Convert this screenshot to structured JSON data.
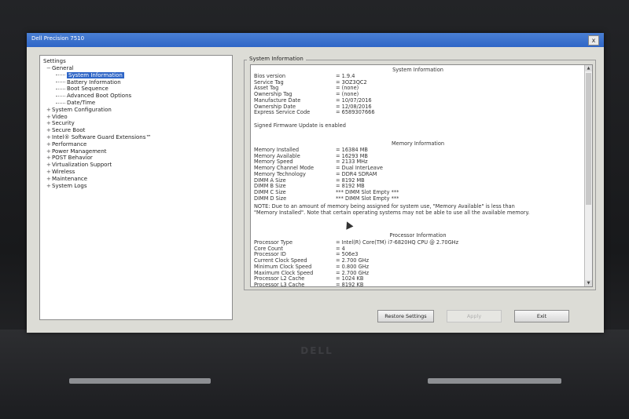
{
  "window": {
    "title": "Dell Precision 7510",
    "close_symbol": "x"
  },
  "tree": {
    "root": "Settings",
    "items": [
      {
        "label": "General",
        "level": 0,
        "expander": "−"
      },
      {
        "label": "System Information",
        "level": 1,
        "selected": true
      },
      {
        "label": "Battery Information",
        "level": 1
      },
      {
        "label": "Boot Sequence",
        "level": 1
      },
      {
        "label": "Advanced Boot Options",
        "level": 1
      },
      {
        "label": "Date/Time",
        "level": 1
      },
      {
        "label": "System Configuration",
        "level": 0,
        "expander": "+"
      },
      {
        "label": "Video",
        "level": 0,
        "expander": "+"
      },
      {
        "label": "Security",
        "level": 0,
        "expander": "+"
      },
      {
        "label": "Secure Boot",
        "level": 0,
        "expander": "+"
      },
      {
        "label": "Intel® Software Guard Extensions™",
        "level": 0,
        "expander": "+"
      },
      {
        "label": "Performance",
        "level": 0,
        "expander": "+"
      },
      {
        "label": "Power Management",
        "level": 0,
        "expander": "+"
      },
      {
        "label": "POST Behavior",
        "level": 0,
        "expander": "+"
      },
      {
        "label": "Virtualization Support",
        "level": 0,
        "expander": "+"
      },
      {
        "label": "Wireless",
        "level": 0,
        "expander": "+"
      },
      {
        "label": "Maintenance",
        "level": 0,
        "expander": "+"
      },
      {
        "label": "System Logs",
        "level": 0,
        "expander": "+"
      }
    ]
  },
  "info": {
    "group_title": "System Information",
    "sections": {
      "system": "System Information",
      "memory": "Memory Information",
      "processor": "Processor Information"
    },
    "system_rows": [
      {
        "k": "Bios version",
        "v": "= 1.9.4"
      },
      {
        "k": "Service Tag",
        "v": "= 3OZ3QC2"
      },
      {
        "k": "Asset Tag",
        "v": "= (none)"
      },
      {
        "k": "Ownership Tag",
        "v": "= (none)"
      },
      {
        "k": "Manufacture Date",
        "v": "= 10/07/2016"
      },
      {
        "k": "Ownership Date",
        "v": "= 12/08/2016"
      },
      {
        "k": "Express Service Code",
        "v": "= 6589307666"
      }
    ],
    "signed_fw": "Signed Firmware Update is enabled",
    "memory_rows": [
      {
        "k": "Memory Installed",
        "v": "= 16384 MB"
      },
      {
        "k": "Memory Available",
        "v": "= 16293 MB"
      },
      {
        "k": "Memory Speed",
        "v": "= 2133 MHz"
      },
      {
        "k": "Memory Channel Mode",
        "v": "= Dual InterLeave"
      },
      {
        "k": "Memory Technology",
        "v": "= DDR4 SDRAM"
      },
      {
        "k": "DIMM A Size",
        "v": "= 8192 MB"
      },
      {
        "k": "DIMM B Size",
        "v": "= 8192 MB"
      },
      {
        "k": "DIMM C Size",
        "v": "*** DIMM Slot Empty ***"
      },
      {
        "k": "DIMM D Size",
        "v": "*** DIMM Slot Empty ***"
      }
    ],
    "note": "NOTE: Due to an amount of memory being assigned for system use, \"Memory Available\" is less than \"Memory Installed\". Note that certain operating systems may not be able to use all the available memory.",
    "processor_rows": [
      {
        "k": "Processor Type",
        "v": "= Intel(R) Core(TM) i7-6820HQ CPU @ 2.70GHz"
      },
      {
        "k": "Core Count",
        "v": "= 4"
      },
      {
        "k": "Processor ID",
        "v": "= 506e3"
      },
      {
        "k": "Current Clock Speed",
        "v": "= 2.700 GHz"
      },
      {
        "k": "Minimum Clock Speed",
        "v": "= 0.800 GHz"
      },
      {
        "k": "Maximum Clock Speed",
        "v": "= 2.700 GHz"
      },
      {
        "k": "Processor L2 Cache",
        "v": "= 1024 KB"
      },
      {
        "k": "Processor L3 Cache",
        "v": "= 8192 KB"
      }
    ],
    "scroll_up": "▲",
    "scroll_down": "▼"
  },
  "buttons": {
    "restore": "Restore Settings",
    "apply": "Apply",
    "exit": "Exit"
  },
  "brand": "DELL"
}
